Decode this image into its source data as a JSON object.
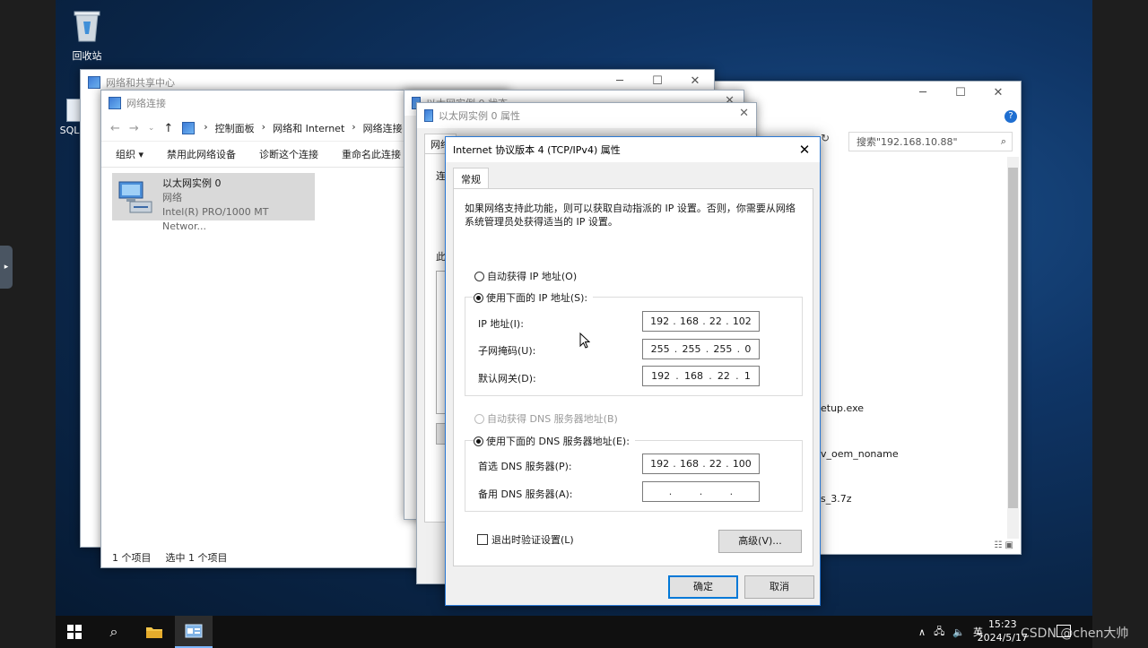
{
  "desktop": {
    "icons": [
      {
        "label": "回收站",
        "icon": "recycle-bin-icon"
      },
      {
        "label": "SQLE",
        "icon": "sql-app-icon"
      }
    ]
  },
  "network_center": {
    "title": "网络和共享中心"
  },
  "explorer": {
    "title": "网络连接",
    "breadcrumb": [
      "控制面板",
      "网络和 Internet",
      "网络连接"
    ],
    "toolbar": [
      "组织 ▾",
      "禁用此网络设备",
      "诊断这个连接",
      "重命名此连接"
    ],
    "item": {
      "name": "以太网实例 0",
      "type": "网络",
      "adapter": "Intel(R) PRO/1000 MT Networ..."
    },
    "status": {
      "count": "1 个项目",
      "selected": "选中 1 个项目"
    }
  },
  "status_window": {
    "title": "以太网实例 0 状态"
  },
  "props_window": {
    "title": "以太网实例 0 属性",
    "tab": "网络",
    "label_conn": "连",
    "label_this": "此"
  },
  "right_window": {
    "search_placeholder": "搜索\"192.168.10.88\"",
    "files": [
      "etup.exe",
      "v_oem_noname",
      "s_3.7z"
    ]
  },
  "dialog": {
    "title": "Internet 协议版本 4 (TCP/IPv4) 属性",
    "tab": "常规",
    "description": "如果网络支持此功能，则可以获取自动指派的 IP 设置。否则，你需要从网络系统管理员处获得适当的 IP 设置。",
    "auto_ip": "自动获得 IP 地址(O)",
    "manual_ip": "使用下面的 IP 地址(S):",
    "ip_label": "IP 地址(I):",
    "ip": [
      "192",
      "168",
      "22",
      "102"
    ],
    "mask_label": "子网掩码(U):",
    "mask": [
      "255",
      "255",
      "255",
      "0"
    ],
    "gateway_label": "默认网关(D):",
    "gateway": [
      "192",
      "168",
      "22",
      "1"
    ],
    "auto_dns": "自动获得 DNS 服务器地址(B)",
    "manual_dns": "使用下面的 DNS 服务器地址(E):",
    "dns1_label": "首选 DNS 服务器(P):",
    "dns1": [
      "192",
      "168",
      "22",
      "100"
    ],
    "dns2_label": "备用 DNS 服务器(A):",
    "dns2": [
      "",
      "",
      "",
      ""
    ],
    "validate": "退出时验证设置(L)",
    "advanced": "高级(V)...",
    "ok": "确定",
    "cancel": "取消"
  },
  "taskbar": {
    "tray_lang": "英",
    "time": "15:23",
    "date": "2024/5/17"
  },
  "watermark": "CSDN @chen大帅"
}
